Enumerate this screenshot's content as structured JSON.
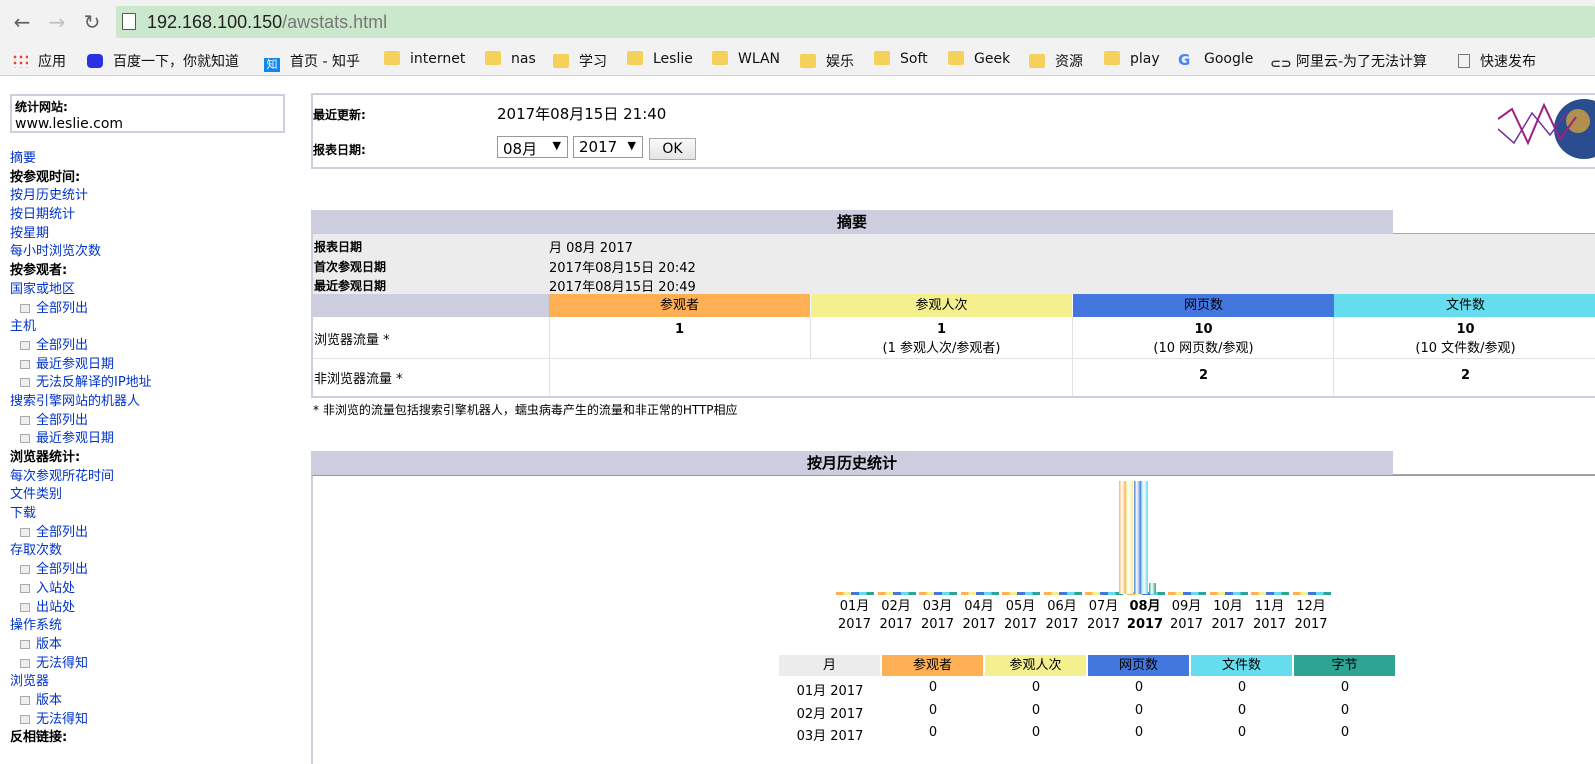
{
  "browser": {
    "url_host": "192.168.100.150",
    "url_path": "/awstats.html",
    "bookmarks": [
      "应用",
      "百度一下，你就知道",
      "首页 - 知乎",
      "internet",
      "nas",
      "学习",
      "Leslie",
      "WLAN",
      "娱乐",
      "Soft",
      "Geek",
      "资源",
      "play",
      "Google",
      "阿里云-为了无法计算",
      "快速发布"
    ]
  },
  "site": {
    "label": "统计网站:",
    "name": "www.leslie.com"
  },
  "menu": [
    {
      "t": "link",
      "label": "摘要"
    },
    {
      "t": "hdr",
      "label": "按参观时间:"
    },
    {
      "t": "link",
      "label": "按月历史统计"
    },
    {
      "t": "link",
      "label": "按日期统计"
    },
    {
      "t": "link",
      "label": "按星期"
    },
    {
      "t": "link",
      "label": "每小时浏览次数"
    },
    {
      "t": "hdr",
      "label": "按参观者:"
    },
    {
      "t": "link",
      "label": "国家或地区"
    },
    {
      "t": "sub",
      "label": "全部列出"
    },
    {
      "t": "link",
      "label": "主机"
    },
    {
      "t": "sub",
      "label": "全部列出"
    },
    {
      "t": "sub",
      "label": "最近参观日期"
    },
    {
      "t": "sub",
      "label": "无法反解译的IP地址"
    },
    {
      "t": "link",
      "label": "搜索引擎网站的机器人"
    },
    {
      "t": "sub",
      "label": "全部列出"
    },
    {
      "t": "sub",
      "label": "最近参观日期"
    },
    {
      "t": "hdr",
      "label": "浏览器统计:"
    },
    {
      "t": "link",
      "label": "每次参观所花时间"
    },
    {
      "t": "link",
      "label": "文件类别"
    },
    {
      "t": "link",
      "label": "下载"
    },
    {
      "t": "sub",
      "label": "全部列出"
    },
    {
      "t": "link",
      "label": "存取次数"
    },
    {
      "t": "sub",
      "label": "全部列出"
    },
    {
      "t": "sub",
      "label": "入站处"
    },
    {
      "t": "sub",
      "label": "出站处"
    },
    {
      "t": "link",
      "label": "操作系统"
    },
    {
      "t": "sub",
      "label": "版本"
    },
    {
      "t": "sub",
      "label": "无法得知"
    },
    {
      "t": "link",
      "label": "浏览器"
    },
    {
      "t": "sub",
      "label": "版本"
    },
    {
      "t": "sub",
      "label": "无法得知"
    },
    {
      "t": "hdr",
      "label": "反相链接:"
    }
  ],
  "top": {
    "last_update_label": "最近更新:",
    "last_update_value": "2017年08月15日 21:40",
    "report_date_label": "报表日期:",
    "month_select": "08月",
    "year_select": "2017",
    "ok": "OK"
  },
  "summary": {
    "title": "摘要",
    "rows": [
      {
        "label": "报表日期",
        "value": "月 08月 2017"
      },
      {
        "label": "首次参观日期",
        "value": "2017年08月15日 20:42"
      },
      {
        "label": "最近参观日期",
        "value": "2017年08月15日 20:49"
      }
    ],
    "columns": [
      "参观者",
      "参观人次",
      "网页数",
      "文件数"
    ],
    "browser_traffic": {
      "label": "浏览器流量 *",
      "visitors": "1",
      "visits": "1",
      "visits_sub": "(1 参观人次/参观者)",
      "pages": "10",
      "pages_sub": "(10 网页数/参观)",
      "hits": "10",
      "hits_sub": "(10 文件数/参观)"
    },
    "nonbrowser_traffic": {
      "label": "非浏览器流量 *",
      "pages": "2",
      "hits": "2"
    },
    "footnote": "* 非浏览的流量包括搜索引擎机器人，蠕虫病毒产生的流量和非正常的HTTP相应"
  },
  "monthly": {
    "title": "按月历史统计",
    "months": [
      "01月",
      "02月",
      "03月",
      "04月",
      "05月",
      "06月",
      "07月",
      "08月",
      "09月",
      "10月",
      "11月",
      "12月"
    ],
    "year": "2017",
    "current_index": 7,
    "table_headers": [
      "月",
      "参观者",
      "参观人次",
      "网页数",
      "文件数",
      "字节"
    ],
    "table_rows": [
      [
        "01月 2017",
        "0",
        "0",
        "0",
        "0",
        "0"
      ],
      [
        "02月 2017",
        "0",
        "0",
        "0",
        "0",
        "0"
      ],
      [
        "03月 2017",
        "0",
        "0",
        "0",
        "0",
        "0"
      ]
    ]
  },
  "colors": {
    "visitors": "#ffb055",
    "visits": "#f4f090",
    "pages": "#4477dd",
    "hits": "#66ddee",
    "bytes": "#2ea495",
    "header_bg": "#cccdde"
  }
}
